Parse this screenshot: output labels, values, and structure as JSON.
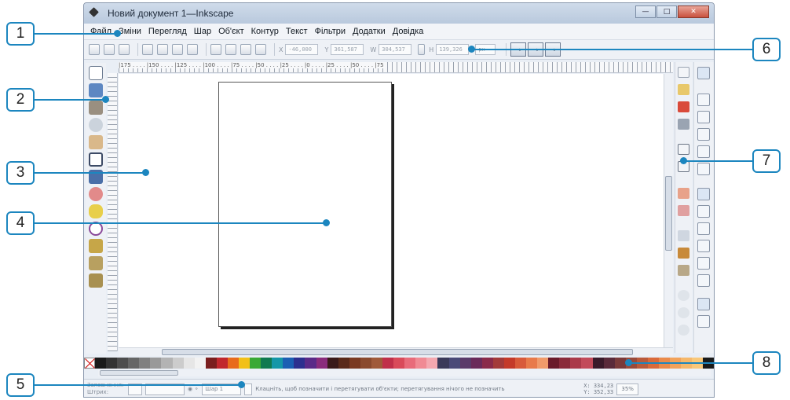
{
  "window": {
    "title": "Новий документ 1—Inkscape"
  },
  "menu": [
    "Файл",
    "Зміни",
    "Перегляд",
    "Шар",
    "Об'єкт",
    "Контур",
    "Текст",
    "Фільтри",
    "Додатки",
    "Довідка"
  ],
  "toolbar": {
    "x_value": "-46,000",
    "y_value": "361,587",
    "w_value": "304,537",
    "h_value": "139,326",
    "unit": "px"
  },
  "ruler": {
    "top_labels": "|175 . . . . |150 . . . . |125 . . . . |100 . . . . |75 . . . . |50 . . . . |25 . . . . |0 . . . . |25 . . . . |50 . . . . |75"
  },
  "statusbar": {
    "fill_label": "Заповнення:",
    "stroke_label": "Штрих:",
    "layer": "Шар 1",
    "message": "Клацніть, щоб позначити і перетягувати об'єкти; перетягування нічого не позначить",
    "coords_x": "X: 334,23",
    "coords_y": "Y: 352,33",
    "zoom": "35%"
  },
  "callouts": [
    "1",
    "2",
    "3",
    "4",
    "5",
    "6",
    "7",
    "8"
  ],
  "palette_colors": [
    "#1a1a1a",
    "#333333",
    "#4d4d4d",
    "#666666",
    "#808080",
    "#999999",
    "#b3b3b3",
    "#cccccc",
    "#e6e6e6",
    "#f2f2f2",
    "#7a1e1e",
    "#c1272d",
    "#e86b1c",
    "#f2c018",
    "#3aa935",
    "#107a50",
    "#1597a8",
    "#1b5fb3",
    "#2c2f8f",
    "#5a2a88",
    "#8a2c7c",
    "#3a1a1a",
    "#5a2a1a",
    "#7a3a22",
    "#8a4a2e",
    "#a05a3a",
    "#c0304a",
    "#d94a5a",
    "#e86b7a",
    "#f08a94",
    "#f4a8b0",
    "#3a3a5a",
    "#4a4a78",
    "#5a3a6a",
    "#6a2a5a",
    "#8a2a4a",
    "#a33a3a",
    "#c43a2a",
    "#d85a3a",
    "#e87a4a",
    "#f09a6a",
    "#6a1a2a",
    "#8a2a3a",
    "#aa3a4a",
    "#c24a5a",
    "#3a1a2a",
    "#5a2a3a",
    "#7a3a3a",
    "#9a4a3a",
    "#ba5a3a",
    "#da6a3a",
    "#ea8a4a",
    "#f2a25a",
    "#f6b86a",
    "#f9c87a",
    "#1a1a1a"
  ]
}
